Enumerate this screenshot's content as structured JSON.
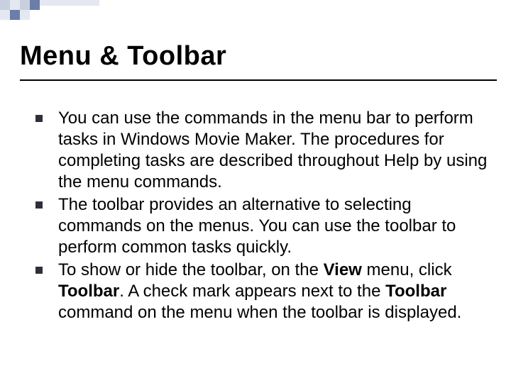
{
  "title": "Menu & Toolbar",
  "bullets": {
    "b1": "You can use the commands in the menu bar to perform tasks in Windows Movie Maker. The procedures for completing tasks are described throughout Help by using the menu commands.",
    "b2": "The toolbar provides an alternative to selecting commands on the menus. You can use the toolbar to perform common tasks quickly.",
    "b3a": "To show or hide the toolbar, on the ",
    "b3view": "View",
    "b3b": " menu, click ",
    "b3toolbar1": "Toolbar",
    "b3c": ". A check mark appears next to the ",
    "b3toolbar2": "Toolbar",
    "b3d": " command on the menu when the toolbar is displayed."
  },
  "colors": {
    "accent1": "#6b7da8",
    "accent2": "#c8d0e0",
    "accent3": "#e4e8f1"
  }
}
